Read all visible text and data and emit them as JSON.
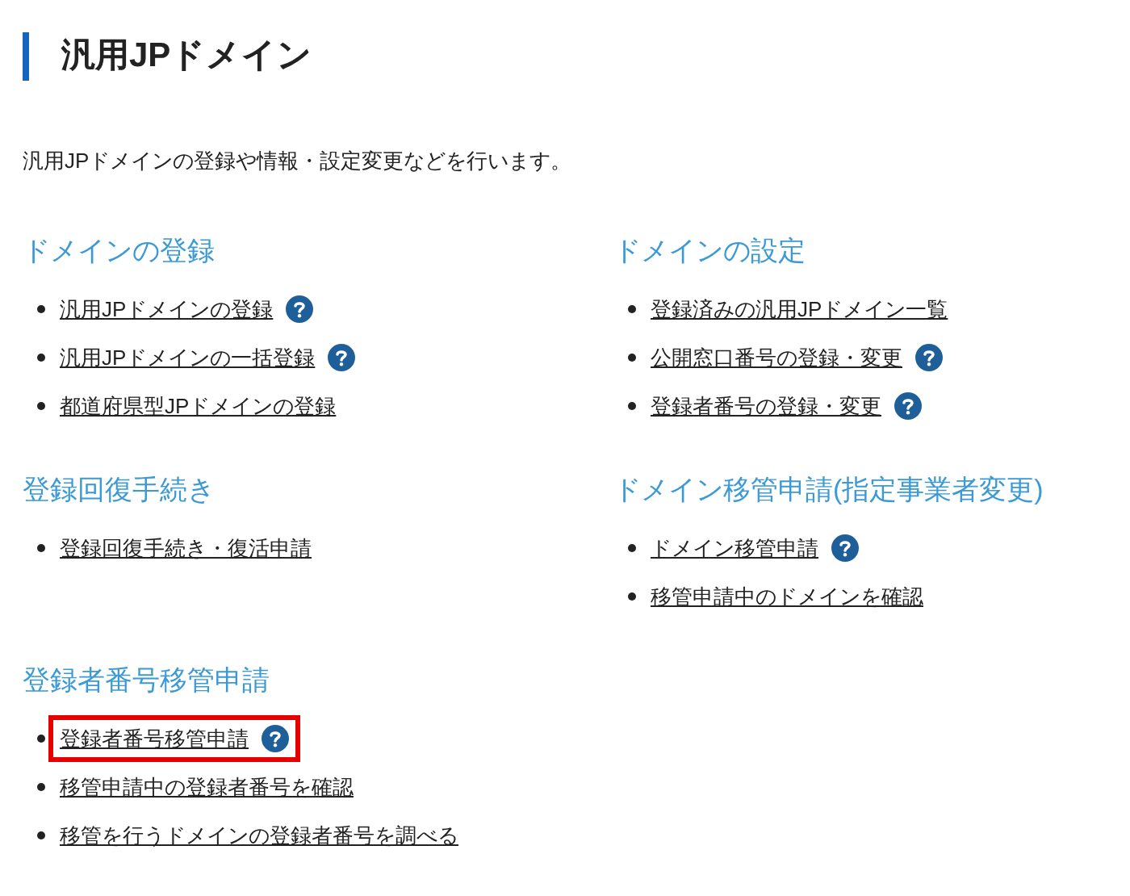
{
  "title": "汎用JPドメイン",
  "intro": "汎用JPドメインの登録や情報・設定変更などを行います。",
  "sections": [
    {
      "heading": "ドメインの登録",
      "items": [
        {
          "label": "汎用JPドメインの登録",
          "help": true,
          "highlighted": false
        },
        {
          "label": "汎用JPドメインの一括登録",
          "help": true,
          "highlighted": false
        },
        {
          "label": "都道府県型JPドメインの登録",
          "help": false,
          "highlighted": false
        }
      ]
    },
    {
      "heading": "ドメインの設定",
      "items": [
        {
          "label": "登録済みの汎用JPドメイン一覧",
          "help": false,
          "highlighted": false
        },
        {
          "label": "公開窓口番号の登録・変更",
          "help": true,
          "highlighted": false
        },
        {
          "label": "登録者番号の登録・変更",
          "help": true,
          "highlighted": false
        }
      ]
    },
    {
      "heading": "登録回復手続き",
      "items": [
        {
          "label": "登録回復手続き・復活申請",
          "help": false,
          "highlighted": false
        }
      ]
    },
    {
      "heading": "ドメイン移管申請(指定事業者変更)",
      "items": [
        {
          "label": "ドメイン移管申請",
          "help": true,
          "highlighted": false
        },
        {
          "label": "移管申請中のドメインを確認",
          "help": false,
          "highlighted": false
        }
      ]
    },
    {
      "heading": "登録者番号移管申請",
      "items": [
        {
          "label": "登録者番号移管申請",
          "help": true,
          "highlighted": true
        },
        {
          "label": "移管申請中の登録者番号を確認",
          "help": false,
          "highlighted": false
        },
        {
          "label": "移管を行うドメインの登録者番号を調べる",
          "help": false,
          "highlighted": false
        }
      ]
    }
  ]
}
